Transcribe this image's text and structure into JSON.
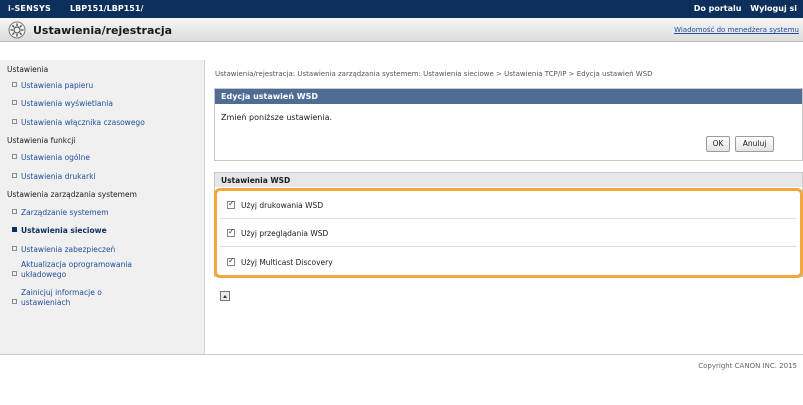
{
  "topbar": {
    "brand": "i-SENSYS",
    "model": "LBP151/LBP151/",
    "link_portal": "Do portalu",
    "link_logout": "Wyloguj si"
  },
  "titlebar": {
    "title": "Ustawienia/rejestracja",
    "message_link": "Wiadomość do menedżera systemu"
  },
  "sidebar": {
    "section_settings": "Ustawienia",
    "item_paper": "Ustawienia papieru",
    "item_display": "Ustawienia wyświetlania",
    "item_timer": "Ustawienia włącznika czasowego",
    "section_functions": "Ustawienia funkcji",
    "item_general": "Ustawienia ogólne",
    "item_printer": "Ustawienia drukarki",
    "section_management": "Ustawienia zarządzania systemem",
    "item_system": "Zarządzanie systemem",
    "item_network": "Ustawienia sieciowe",
    "item_security": "Ustawienia zabezpieczeń",
    "item_firmware_line1": "Aktualizacja oprogramowania",
    "item_firmware_line2": "układowego",
    "item_register_line1": "Zainicjuj informacje o",
    "item_register_line2": "ustawieniach"
  },
  "breadcrumb": "Ustawienia/rejestracja: Ustawienia zarządzania systemem: Ustawienia sieciowe > Ustawienia TCP/IP > Edycja ustawień WSD",
  "edit_panel": {
    "heading": "Edycja ustawień WSD",
    "instruction": "Zmień poniższe ustawienia.",
    "ok_label": "OK",
    "cancel_label": "Anuluj"
  },
  "wsd_panel": {
    "heading": "Ustawienia WSD",
    "options": [
      {
        "label": "Użyj drukowania WSD",
        "checked": true
      },
      {
        "label": "Użyj przeglądania WSD",
        "checked": true
      },
      {
        "label": "Użyj Multicast Discovery",
        "checked": true
      }
    ]
  },
  "footer": {
    "copyright": "Copyright CANON INC. 2015"
  },
  "colors": {
    "topbar": "#0d2f5c",
    "panel_header": "#4f6c94",
    "highlight": "#f3a63b",
    "link": "#1f4e9c"
  }
}
